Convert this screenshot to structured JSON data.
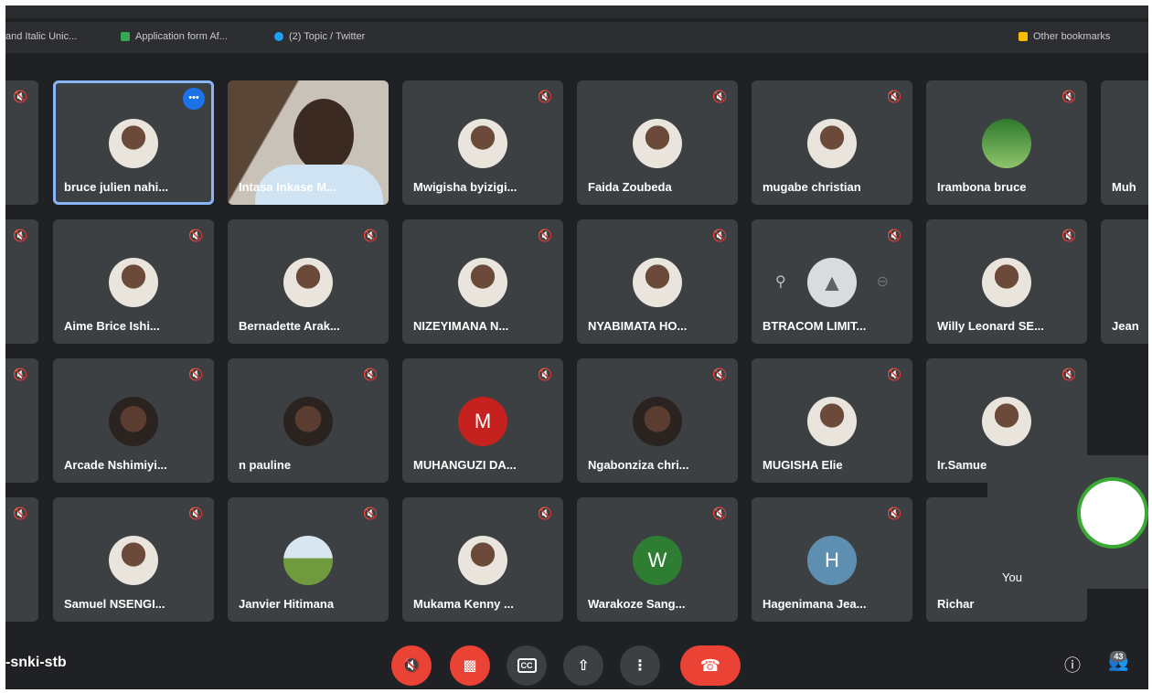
{
  "bookmarks": {
    "items": [
      {
        "label": "and Italic Unic...",
        "icon": "document-icon",
        "color": "#c8c9cc"
      },
      {
        "label": "Application form Af...",
        "icon": "google-forms-icon",
        "color": "#34a853"
      },
      {
        "label": "(2) Topic / Twitter",
        "icon": "twitter-icon",
        "color": "#1da1f2"
      }
    ],
    "other": {
      "label": "Other bookmarks",
      "icon": "folder-icon",
      "color": "#fbbc04"
    }
  },
  "participants": [
    {
      "name": "bruce julien nahi...",
      "avatar": "photo",
      "active": true,
      "muted": false
    },
    {
      "name": "Intasa Inkase M...",
      "avatar": "video",
      "muted": false
    },
    {
      "name": "Mwigisha byizigi...",
      "avatar": "photo",
      "muted": true
    },
    {
      "name": "Faida Zoubeda",
      "avatar": "photo",
      "muted": true
    },
    {
      "name": "mugabe christian",
      "avatar": "photo",
      "muted": true
    },
    {
      "name": "Irambona bruce",
      "avatar": "green",
      "muted": true
    },
    {
      "name": "Aime Brice Ishi...",
      "avatar": "photo",
      "muted": true
    },
    {
      "name": "Bernadette Arak...",
      "avatar": "photo",
      "muted": true
    },
    {
      "name": "NIZEYIMANA N...",
      "avatar": "photo",
      "muted": true
    },
    {
      "name": "NYABIMATA HO...",
      "avatar": "photo",
      "muted": true
    },
    {
      "name": "BTRACOM LIMIT...",
      "avatar": "logo",
      "muted": true
    },
    {
      "name": "Willy Leonard SE...",
      "avatar": "photo",
      "muted": true
    },
    {
      "name": "Arcade Nshimiyi...",
      "avatar": "dark",
      "muted": true
    },
    {
      "name": "n pauline",
      "avatar": "dark",
      "muted": true
    },
    {
      "name": "MUHANGUZI DA...",
      "avatar": "letter",
      "letter": "M",
      "letter_color": "#c5221f",
      "muted": true
    },
    {
      "name": "Ngabonziza chri...",
      "avatar": "dark",
      "muted": true
    },
    {
      "name": "MUGISHA Elie",
      "avatar": "photo",
      "muted": true
    },
    {
      "name": "Ir.Samuel Rubiga...",
      "avatar": "photo",
      "muted": true
    },
    {
      "name": "Samuel NSENGI...",
      "avatar": "photo",
      "muted": true
    },
    {
      "name": "Janvier Hitimana",
      "avatar": "land",
      "muted": true
    },
    {
      "name": "Mukama Kenny ...",
      "avatar": "photo",
      "muted": true
    },
    {
      "name": "Warakoze Sang...",
      "avatar": "letter",
      "letter": "W",
      "letter_color": "#2e7d32",
      "muted": true
    },
    {
      "name": "Hagenimana Jea...",
      "avatar": "letter",
      "letter": "H",
      "letter_color": "#5f8fb0",
      "muted": true
    },
    {
      "name": "Richar",
      "avatar": "none",
      "muted": false
    }
  ],
  "edge_names": [
    "Muh",
    "Jean"
  ],
  "self_tile": {
    "label": "You"
  },
  "controls": {
    "meeting_code": "-snki-stb",
    "mic_icon": "mic-off-icon",
    "cam_icon": "camera-off-icon",
    "cc_label": "CC",
    "present_icon": "present-icon",
    "more_icon": "more-vert-icon",
    "hangup_icon": "hangup-icon",
    "info_icon": "info-icon",
    "people_icon": "people-icon",
    "people_count": "43"
  },
  "colors": {
    "accent": "#8ab4f8",
    "danger": "#ea4335",
    "tile": "#3c4043",
    "background": "#202124"
  }
}
